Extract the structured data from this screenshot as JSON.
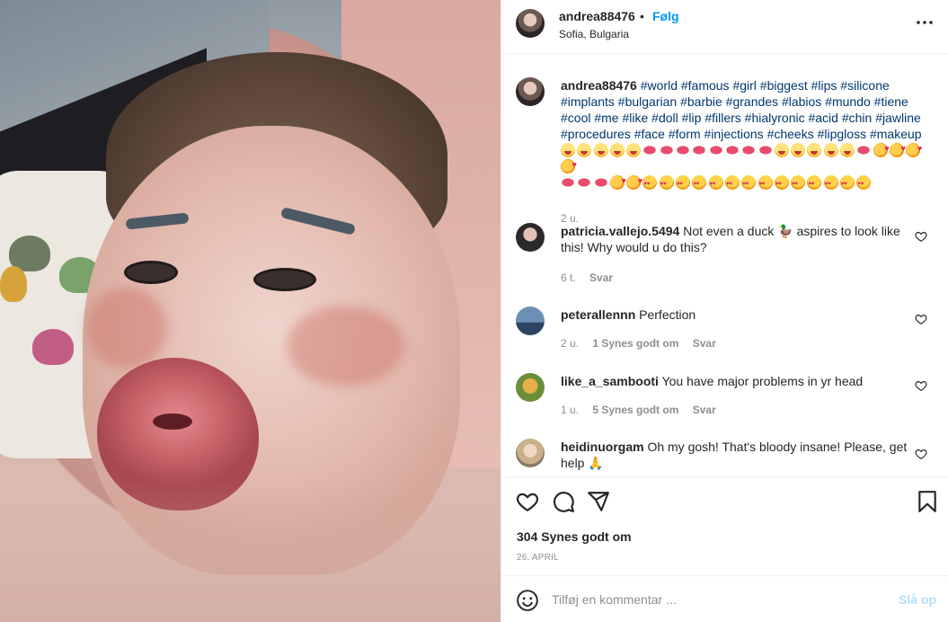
{
  "post": {
    "username": "andrea88476",
    "separator": "•",
    "follow_label": "Følg",
    "location": "Sofia, Bulgaria",
    "more_icon": "more-options-icon"
  },
  "caption": {
    "username": "andrea88476",
    "hashtags": "#world #famous #girl #biggest #lips #silicone #implants #bulgarian #barbie #grandes #labios #mundo #tiene #cool #me #like #doll #lip #fillers #hialyronic #acid #chin #jawline #procedures #face #form #injections #cheeks #lipgloss #makeup",
    "emoji_line1": [
      "zany",
      "zany",
      "zany",
      "zany",
      "zany",
      "lips",
      "lips",
      "lips",
      "lips",
      "lips",
      "lips",
      "lips",
      "lips",
      "zany",
      "zany",
      "zany",
      "zany",
      "zany",
      "lips",
      "hug",
      "hug",
      "hug",
      "hug"
    ],
    "emoji_line2": [
      "lips",
      "lips",
      "lips",
      "hug",
      "hug",
      "heart-eyes",
      "heart-eyes",
      "heart-eyes",
      "heart-eyes",
      "heart-eyes",
      "heart-eyes",
      "heart-eyes",
      "heart-eyes",
      "heart-eyes",
      "heart-eyes",
      "heart-eyes",
      "heart-eyes",
      "heart-eyes",
      "heart-eyes"
    ],
    "time": "2 u."
  },
  "comments": [
    {
      "username": "patricia.vallejo.5494",
      "text": "Not even a duck 🦆 aspires to look like this! Why would u do this?",
      "time": "6 t.",
      "likes": "",
      "reply": "Svar",
      "avatar_color": "#2a2a2a"
    },
    {
      "username": "peterallennn",
      "text": "Perfection",
      "time": "2 u.",
      "likes": "1 Synes godt om",
      "reply": "Svar",
      "avatar_color": "#4a6e96"
    },
    {
      "username": "like_a_sambooti",
      "text": "You have major problems in yr head",
      "time": "1 u.",
      "likes": "5 Synes godt om",
      "reply": "Svar",
      "avatar_color": "#6b8e3a"
    },
    {
      "username": "heidinuorgam",
      "text": "Oh my gosh! That's bloody insane! Please, get help 🙏",
      "time": "",
      "likes": "",
      "reply": "",
      "avatar_color": "#c9b089"
    }
  ],
  "actions": {
    "like_icon": "heart-icon",
    "comment_icon": "comment-icon",
    "share_icon": "share-icon",
    "save_icon": "bookmark-icon",
    "likes_count": "304 Synes godt om",
    "date": "26. APRIL"
  },
  "add_comment": {
    "placeholder": "Tilføj en kommentar ...",
    "post_label": "Slå op",
    "emoji_icon": "emoji-smiley-icon"
  },
  "colors": {
    "link_blue": "#0095f6",
    "hashtag": "#00376b",
    "muted": "#8e8e8e",
    "post_disabled": "#b2dffc",
    "border": "#efefef"
  }
}
